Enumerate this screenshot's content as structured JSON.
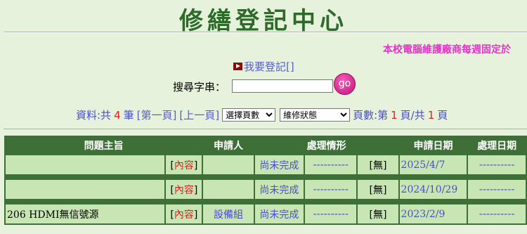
{
  "header": {
    "title": "修繕登記中心",
    "marquee": "本校電腦維護廠商每週固定於"
  },
  "register": {
    "label": "我要登記[]"
  },
  "search": {
    "label": "搜尋字串：",
    "value": "",
    "go_label": "go"
  },
  "pager": {
    "prefix": "資料:共",
    "total": "4",
    "unit": "筆",
    "first": "[第一頁]",
    "prev": "[上一頁]",
    "page_select": "選擇頁數",
    "status_select": "維修狀態",
    "pages_label": "頁數:第",
    "current": "1",
    "of": "頁/共",
    "count": "1",
    "suffix": "頁"
  },
  "table": {
    "headers": [
      "問題主旨",
      "申請人",
      "處理情形",
      "申請日期",
      "處理日期"
    ],
    "rows": [
      {
        "subject": "",
        "content_l": "[",
        "content": "內容",
        "content_r": "]",
        "applicant": "",
        "status": "尚未完成",
        "dash": "----------",
        "flag": "[無]",
        "date": "2025/4/7",
        "done": "----------"
      },
      {
        "subject": "",
        "content_l": "[",
        "content": "內容",
        "content_r": "]",
        "applicant": "",
        "status": "尚未完成",
        "dash": "----------",
        "flag": "[無]",
        "date": "2024/10/29",
        "done": "----------"
      },
      {
        "subject": "206 HDMI無信號源",
        "content_l": "[",
        "content": "內容",
        "content_r": "]",
        "applicant": "設備組",
        "status": "尚未完成",
        "dash": "----------",
        "flag": "[無]",
        "date": "2023/2/9",
        "done": "----------"
      }
    ]
  }
}
